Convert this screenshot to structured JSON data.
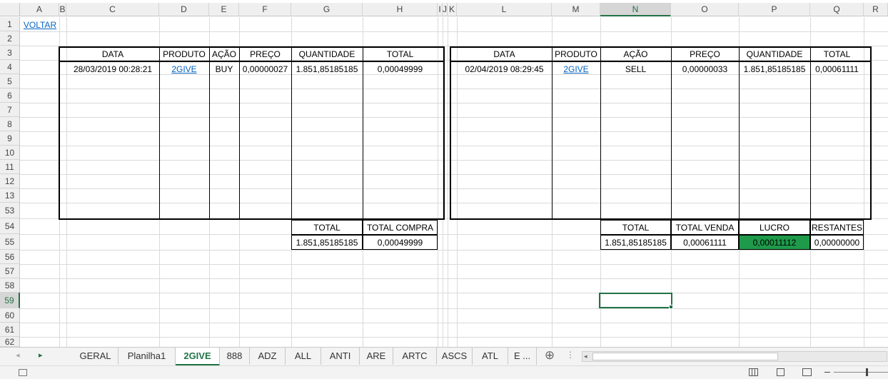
{
  "columns": [
    "A",
    "B",
    "C",
    "D",
    "E",
    "F",
    "G",
    "H",
    "I",
    "J",
    "K",
    "L",
    "M",
    "N",
    "O",
    "P",
    "Q",
    "R"
  ],
  "selected_column": "N",
  "rows": [
    "1",
    "2",
    "3",
    "4",
    "5",
    "6",
    "7",
    "8",
    "9",
    "10",
    "11",
    "12",
    "13",
    "53",
    "54",
    "55",
    "56",
    "57",
    "58",
    "59",
    "60",
    "61",
    "62"
  ],
  "selected_row": "59",
  "link_voltar": "VOLTAR",
  "buy_table": {
    "headers": [
      "DATA",
      "PRODUTO",
      "AÇÃO",
      "PREÇO",
      "QUANTIDADE",
      "TOTAL"
    ],
    "row": {
      "data": "28/03/2019 00:28:21",
      "produto": "2GIVE",
      "acao": "BUY",
      "preco": "0,00000027",
      "quantidade": "1.851,85185185",
      "total": "0,00049999"
    },
    "summary_headers": [
      "TOTAL",
      "TOTAL COMPRA"
    ],
    "summary_values": [
      "1.851,85185185",
      "0,00049999"
    ]
  },
  "sell_table": {
    "headers": [
      "DATA",
      "PRODUTO",
      "AÇÃO",
      "PREÇO",
      "QUANTIDADE",
      "TOTAL"
    ],
    "row": {
      "data": "02/04/2019 08:29:45",
      "produto": "2GIVE",
      "acao": "SELL",
      "preco": "0,00000033",
      "quantidade": "1.851,85185185",
      "total": "0,00061111"
    },
    "summary_headers": [
      "TOTAL",
      "TOTAL VENDA",
      "LUCRO",
      "RESTANTES"
    ],
    "summary_values": [
      "1.851,85185185",
      "0,00061111",
      "0,00011112",
      "0,00000000"
    ]
  },
  "profit_color": "#1e9a4a",
  "accent_color": "#217346",
  "sheet_tabs": [
    "GERAL",
    "Planilha1",
    "2GIVE",
    "888",
    "ADZ",
    "ALL",
    "ANTI",
    "ARE",
    "ARTC",
    "ASCS",
    "ATL",
    "E ..."
  ],
  "active_tab": "2GIVE",
  "tab_nav": {
    "next": "▸",
    "add": "⊕",
    "more": "⋮",
    "scroll_left": "◂"
  }
}
